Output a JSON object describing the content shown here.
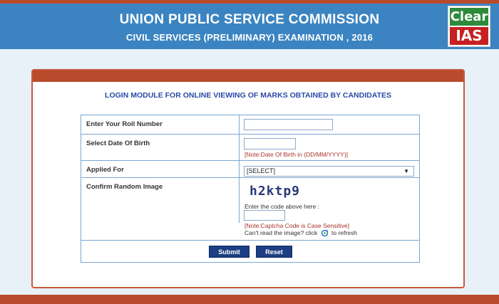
{
  "header": {
    "title": "UNION PUBLIC SERVICE COMMISSION",
    "subtitle": "CIVIL SERVICES (PRELIMINARY) EXAMINATION , 2016"
  },
  "logo": {
    "line1": "Clear",
    "line2": "IAS",
    "top_color": "#2e8b3a",
    "bottom_color": "#c62020"
  },
  "panel": {
    "title": "LOGIN MODULE FOR ONLINE VIEWING OF MARKS OBTAINED BY CANDIDATES"
  },
  "form": {
    "roll_label": "Enter Your Roll Number",
    "roll_value": "",
    "dob_label": "Select Date Of Birth",
    "dob_value": "",
    "dob_note": "[Note:Date Of Birth in (DD/MM/YYYY)]",
    "applied_label": "Applied For",
    "applied_selected": "[SELECT]",
    "captcha_label": "Confirm Random Image",
    "captcha_text": "h2ktp9",
    "captcha_prompt": "Enter the code above here :",
    "captcha_value": "",
    "captcha_note": "[Note:Captcha Code is Case Sensitive]",
    "refresh_prefix": "Can't read the image? click",
    "refresh_suffix": "to refresh",
    "submit_label": "Submit",
    "reset_label": "Reset"
  },
  "colors": {
    "accent": "#b94a2c",
    "header_bg": "#3b84c1",
    "button_bg": "#1c3e82",
    "title_blue": "#2a4aa8",
    "note_red": "#a8322a"
  }
}
